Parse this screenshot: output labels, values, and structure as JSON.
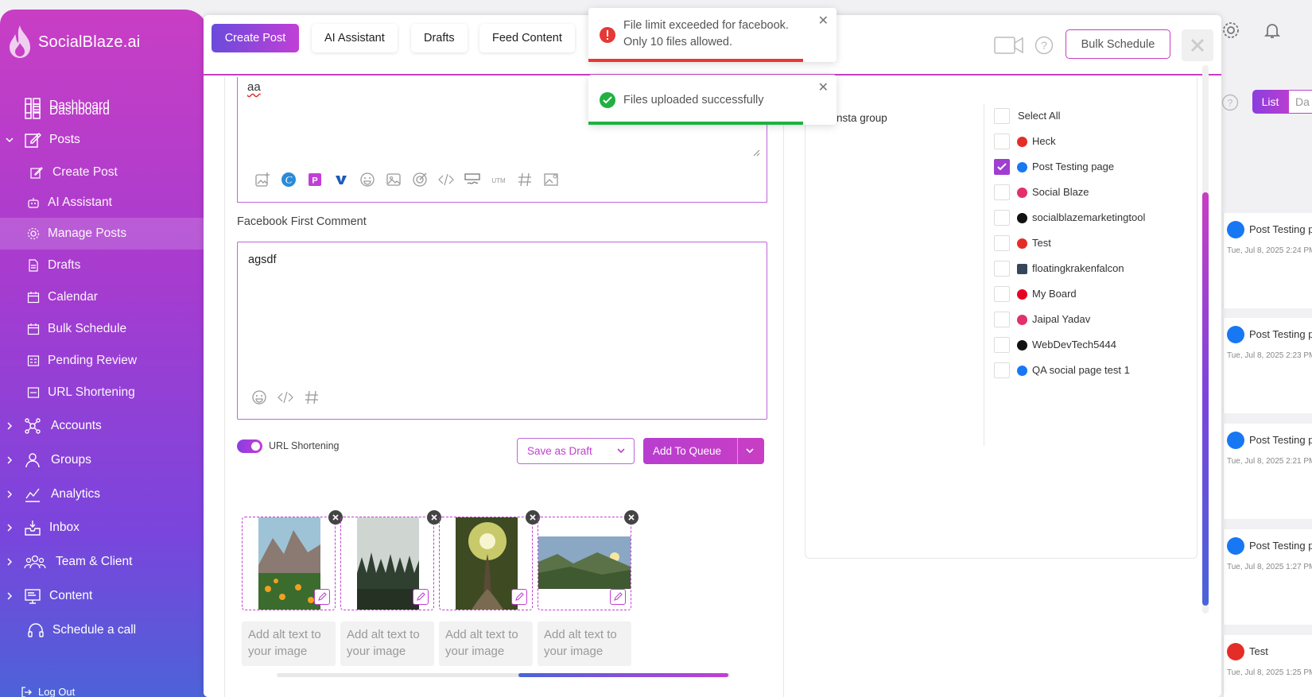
{
  "brand": {
    "name": "SocialBlaze.ai"
  },
  "sidebar": {
    "items": [
      {
        "label": "Dashboard"
      },
      {
        "label": "Posts"
      },
      {
        "label": "Create Post"
      },
      {
        "label": "AI Assistant"
      },
      {
        "label": "Manage Posts"
      },
      {
        "label": "Drafts"
      },
      {
        "label": "Calendar"
      },
      {
        "label": "Bulk Schedule"
      },
      {
        "label": "Pending Review"
      },
      {
        "label": "URL Shortening"
      },
      {
        "label": "Accounts"
      },
      {
        "label": "Groups"
      },
      {
        "label": "Analytics"
      },
      {
        "label": "Inbox"
      },
      {
        "label": "Team & Client"
      },
      {
        "label": "Content"
      },
      {
        "label": "Schedule a call"
      },
      {
        "label": "Log Out"
      }
    ]
  },
  "modal": {
    "tabs": [
      {
        "label": "Create Post"
      },
      {
        "label": "AI Assistant"
      },
      {
        "label": "Drafts"
      },
      {
        "label": "Feed Content"
      }
    ],
    "bulk_schedule": "Bulk Schedule",
    "editor_text": "aa",
    "first_comment_label": "Facebook First Comment",
    "first_comment_text": "agsdf",
    "url_shortening_label": "URL Shortening",
    "save_draft": "Save as Draft",
    "add_queue": "Add To Queue",
    "alt_placeholder": "Add alt text to your image",
    "group_name": "insta group",
    "select_all": "Select All",
    "accounts": [
      {
        "name": "Heck",
        "platform": "youtube",
        "color": "#e52d27",
        "checked": false
      },
      {
        "name": "Post Testing page",
        "platform": "facebook",
        "color": "#1877f2",
        "checked": true
      },
      {
        "name": "Social Blaze",
        "platform": "instagram",
        "color": "#e1306c",
        "checked": false
      },
      {
        "name": "socialblazemarketingtool",
        "platform": "tiktok",
        "color": "#111111",
        "checked": false
      },
      {
        "name": "Test",
        "platform": "youtube",
        "color": "#e52d27",
        "checked": false
      },
      {
        "name": "floatingkrakenfalcon",
        "platform": "tumblr",
        "color": "#35465c",
        "checked": false
      },
      {
        "name": "My Board",
        "platform": "pinterest",
        "color": "#e60023",
        "checked": false
      },
      {
        "name": "Jaipal Yadav",
        "platform": "instagram",
        "color": "#e1306c",
        "checked": false
      },
      {
        "name": "WebDevTech5444",
        "platform": "x",
        "color": "#111111",
        "checked": false
      },
      {
        "name": "QA social page test 1",
        "platform": "facebook",
        "color": "#1877f2",
        "checked": false
      }
    ]
  },
  "toasts": [
    {
      "message_line1": "File limit exceeded for facebook.",
      "message_line2": "Only 10 files allowed.",
      "type": "error",
      "color": "#e53935"
    },
    {
      "message_line1": "Files uploaded successfully",
      "type": "success",
      "color": "#1fb141"
    }
  ],
  "background": {
    "view_list": "List",
    "view_day": "Da",
    "posts": [
      {
        "name": "Post Testing p",
        "date": "Tue, Jul 8, 2025 2:24 PM",
        "platform": "facebook"
      },
      {
        "name": "Post Testing p",
        "date": "Tue, Jul 8, 2025 2:23 PM",
        "platform": "facebook"
      },
      {
        "name": "Post Testing p",
        "date": "Tue, Jul 8, 2025 2:21 PM",
        "platform": "facebook"
      },
      {
        "name": "Post Testing p",
        "date": "Tue, Jul 8, 2025 1:27 PM",
        "platform": "facebook"
      },
      {
        "name": "Test",
        "date": "Tue, Jul 8, 2025 1:25 PM",
        "platform": "youtube"
      }
    ]
  }
}
